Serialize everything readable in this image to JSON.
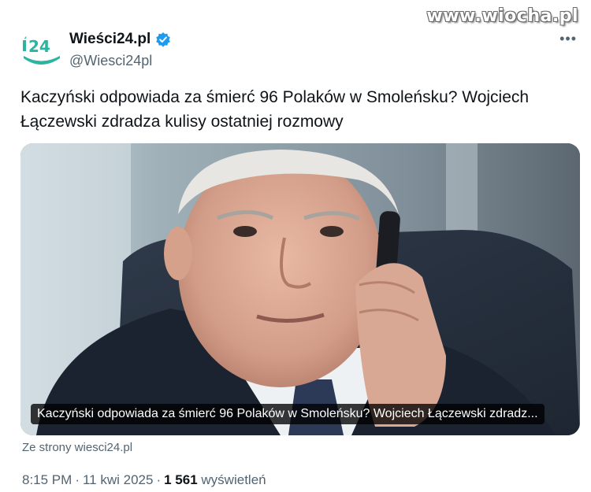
{
  "watermark": "www.wiocha.pl",
  "author": {
    "display_name": "Wieści24.pl",
    "handle": "@Wiesci24pl",
    "avatar_icon": "i24-logo-icon",
    "verified_icon": "verified-badge-icon"
  },
  "tweet": {
    "text": "Kaczyński odpowiada za śmierć 96 Polaków w Smoleńsku? Wojciech Łączewski zdradza kulisy ostatniej rozmowy"
  },
  "card": {
    "caption": "Kaczyński odpowiada za śmierć 96 Polaków w Smoleńsku? Wojciech Łączewski zdradz...",
    "image_description": "man-on-phone-photo"
  },
  "source": "Ze strony wiesci24.pl",
  "meta": {
    "time": "8:15 PM",
    "separator": "·",
    "date": "11 kwi 2025",
    "views_count": "1 561",
    "views_label": "wyświetleń"
  },
  "more_icon": "more-options-icon",
  "colors": {
    "text": "#0f1419",
    "secondary": "#536471",
    "verified": "#1d9bf0",
    "logo_green": "#2bb5a0"
  }
}
